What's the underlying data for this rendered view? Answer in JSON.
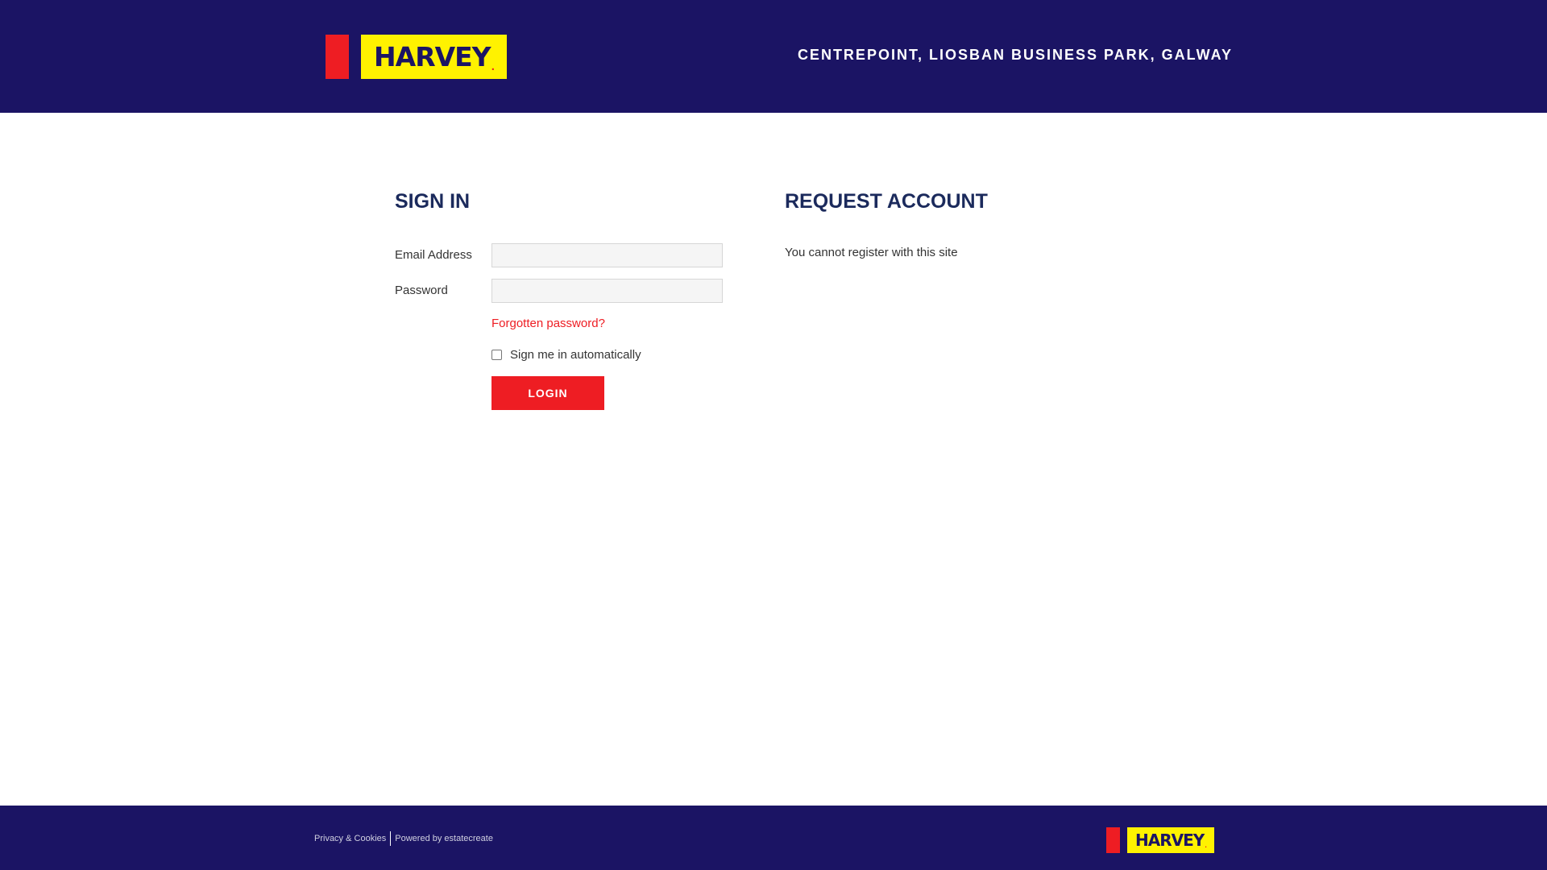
{
  "header": {
    "logo_text": "HARVEY",
    "logo_dot": ".",
    "address": "CENTREPOINT, LIOSBAN BUSINESS PARK, GALWAY"
  },
  "signin": {
    "heading": "SIGN IN",
    "email_label": "Email Address",
    "email_value": "",
    "password_label": "Password",
    "password_value": "",
    "forgot_link": "Forgotten password?",
    "remember_label": "Sign me in automatically",
    "remember_checked": false,
    "login_button": "LOGIN"
  },
  "request": {
    "heading": "REQUEST ACCOUNT",
    "message": "You cannot register with this site"
  },
  "footer": {
    "privacy_link": "Privacy & Cookies",
    "powered_by": "Powered by estatecreate",
    "logo_text": "HARVEY",
    "logo_dot": "."
  },
  "colors": {
    "brand_navy": "#1b1464",
    "brand_red": "#ee1d23",
    "brand_yellow": "#fff200",
    "heading_navy": "#1b2a5c"
  }
}
